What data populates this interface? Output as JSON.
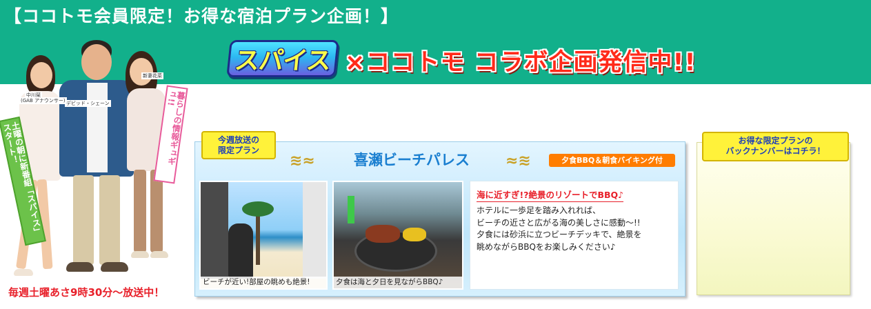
{
  "header": {
    "title": "【ココトモ会員限定！お得な宿泊プラン企画！】",
    "logo_text": "スパイス",
    "collab": "×ココトモ コラボ企画発信中!!"
  },
  "hosts": {
    "names": [
      "中川栞",
      "(GAB アナウンサー)",
      "デビッド・シェーン",
      "新妻花菜"
    ],
    "banner_left": "土曜の朝に新番組「スパイス」スタート！",
    "banner_right": "暮らしの情報ギュギュ!!",
    "broadcast": "毎週土曜あさ9時30分〜放送中！"
  },
  "plan": {
    "tag": [
      "今週放送の",
      "限定プラン"
    ],
    "hotel_name": "喜瀬ビーチパレス",
    "meal_tag": "夕食BBQ＆朝食バイキング付",
    "photo1_caption": "ビーチが近い!部屋の眺めも絶景!",
    "photo2_caption": "夕食は海と夕日を見ながらBBQ♪",
    "desc_heading": "海に近すぎ!?絶景のリゾートでBBQ♪",
    "desc_lines": [
      "ホテルに一歩足を踏み入れれば、",
      "ビーチの近さと広がる海の美しさに感動〜!!",
      "夕食には砂浜に立つビーチデッキで、絶景を",
      "眺めながらBBQをお楽しみください♪"
    ]
  },
  "back_numbers": {
    "tag": [
      "お得な限定プランの",
      "バックナンバーはコチラ！"
    ]
  },
  "colors": {
    "header_green": "#12b08b",
    "accent_red": "#e8202a",
    "hotel_blue": "#1a7fd0",
    "tag_yellow": "#fff23a",
    "meal_orange": "#ff7d00"
  }
}
